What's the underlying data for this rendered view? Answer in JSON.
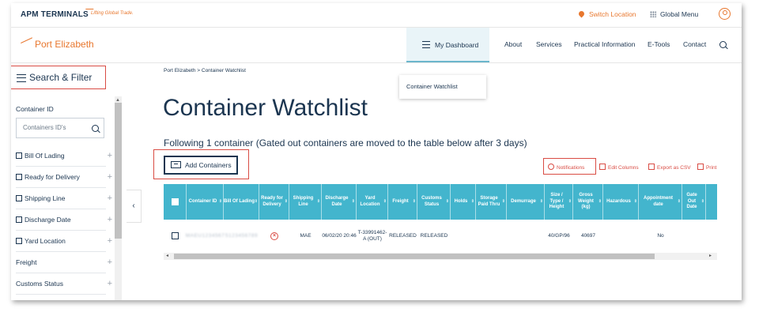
{
  "topbar": {
    "brand": "APM TERMINALS",
    "tagline": "Lifting Global Trade.",
    "switch_location": "Switch Location",
    "global_menu": "Global Menu"
  },
  "nav": {
    "logo": "Port Elizabeth",
    "dashboard": "My Dashboard",
    "links": [
      "About",
      "Services",
      "Practical Information",
      "E-Tools",
      "Contact"
    ],
    "dropdown_item": "Container Watchlist"
  },
  "sidebar": {
    "heading": "Search & Filter",
    "container_id_label": "Container ID",
    "container_id_placeholder": "Containers ID's",
    "filters": [
      {
        "label": "Bill Of Lading",
        "checkbox": true
      },
      {
        "label": "Ready for Delivery",
        "checkbox": true
      },
      {
        "label": "Shipping Line",
        "checkbox": true
      },
      {
        "label": "Discharge Date",
        "checkbox": true
      },
      {
        "label": "Yard Location",
        "checkbox": true
      },
      {
        "label": "Freight",
        "checkbox": false
      },
      {
        "label": "Customs Status",
        "checkbox": false
      }
    ]
  },
  "main": {
    "breadcrumb": "Port Elizabeth  > Container Watchlist",
    "title": "Container Watchlist",
    "subtitle": "Following 1 container (Gated out containers are moved to the table below after 3 days)",
    "add_button": "Add Containers",
    "tools": {
      "notifications": "Notifications",
      "edit_columns": "Edit Columns",
      "export": "Export as CSV",
      "print": "Print"
    }
  },
  "table": {
    "columns": [
      "Container ID",
      "Bill Of Lading",
      "Ready for Delivery",
      "Shipping Line",
      "Discharge Date",
      "Yard Location",
      "Freight",
      "Customs Status",
      "Holds",
      "Storage Paid Thru",
      "Demurrage",
      "Size / Type / Height",
      "Gross Weight (kg)",
      "Hazardous",
      "Appointment date",
      "Gate Out Date"
    ],
    "row": {
      "container_id": "MAEU1234567",
      "bill_of_lading": "5123456789",
      "shipping_line": "MAE",
      "discharge_date": "06/02/20 20:46",
      "yard_location": "T-33991462-A (OUT)",
      "freight": "RELEASED",
      "customs_status": "RELEASED",
      "size_type_height": "40/GP/96",
      "gross_weight": "40697",
      "appointment_date": "No"
    }
  },
  "colors": {
    "accent": "#e8772e",
    "navy": "#1b3550",
    "table_header": "#43b5cd",
    "highlight": "#d94c44"
  }
}
